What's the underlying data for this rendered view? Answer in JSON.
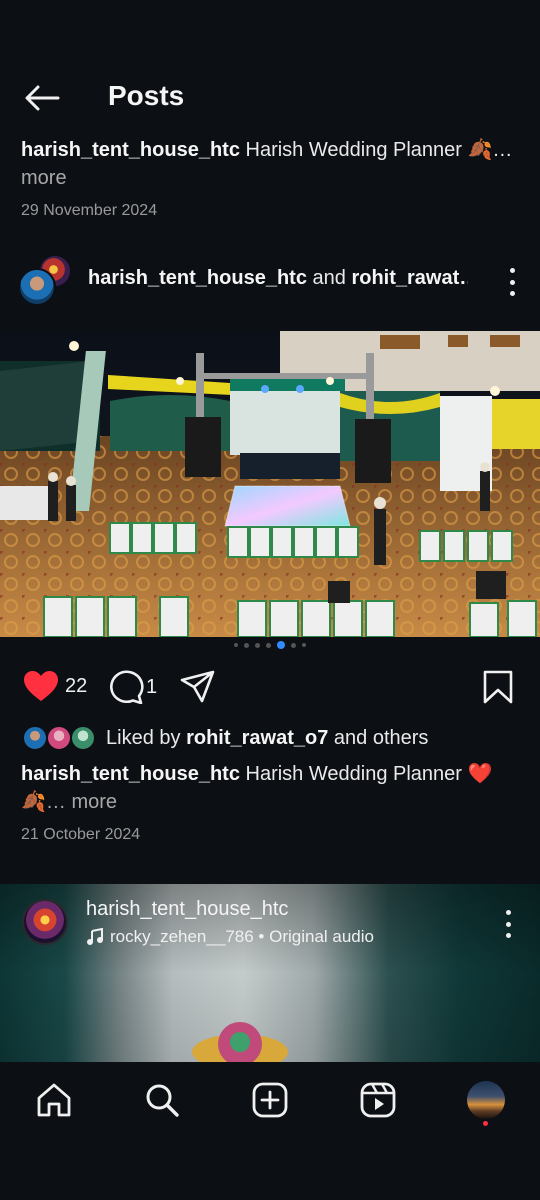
{
  "header": {
    "title": "Posts"
  },
  "prev_post": {
    "username": "harish_tent_house_htc",
    "caption": "Harish Wedding Planner",
    "caption_suffix": "…",
    "more": "more",
    "date": "29 November 2024"
  },
  "post": {
    "author": "harish_tent_house_htc",
    "connector": "and",
    "coauthor": "rohit_rawat…",
    "likes": "22",
    "comments": "1",
    "liked_by_prefix": "Liked by",
    "liked_by_user": "rohit_rawat_o7",
    "liked_by_suffix": "and others",
    "caption_user": "harish_tent_house_htc",
    "caption": "Harish Wedding Planner",
    "caption_more": "… more",
    "date": "21 October 2024",
    "carousel": {
      "count": 7,
      "active_index": 4
    }
  },
  "reel": {
    "username": "harish_tent_house_htc",
    "audio_user": "rocky_zehen__786",
    "audio_separator": "•",
    "audio_label": "Original audio"
  },
  "icons": {
    "back": "arrow-left-icon",
    "more": "more-vertical-icon",
    "like": "heart-icon",
    "comment": "comment-icon",
    "share": "send-icon",
    "save": "bookmark-icon",
    "music": "music-note-icon",
    "nav": [
      "home-icon",
      "search-icon",
      "create-icon",
      "reels-icon",
      "profile-avatar"
    ]
  },
  "colors": {
    "background": "#0c0f14",
    "like": "#ff3040",
    "accent": "#2f8bff",
    "muted": "#9a9a9a"
  }
}
